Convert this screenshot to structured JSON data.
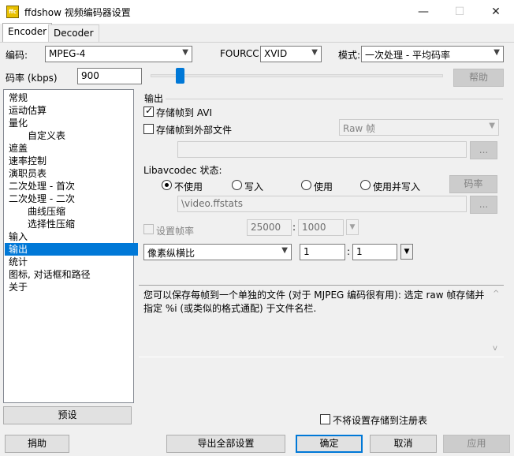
{
  "window": {
    "title": "ffdshow 视频编码器设置",
    "icon_text": "ffc"
  },
  "tabs": [
    {
      "label": "Encoder"
    },
    {
      "label": "Decoder"
    }
  ],
  "top": {
    "codec_label": "编码:",
    "codec_value": "MPEG-4",
    "fourcc_label": "FOURCC:",
    "fourcc_value": "XVID",
    "mode_label": "模式:",
    "mode_value": "一次处理 - 平均码率",
    "bitrate_label": "码率 (kbps)",
    "bitrate_value": "900",
    "slider_fraction": 0.09,
    "help_button": "帮助"
  },
  "tree": [
    {
      "label": "常规"
    },
    {
      "label": "运动估算"
    },
    {
      "label": "量化"
    },
    {
      "label": "自定义表"
    },
    {
      "label": "遮盖"
    },
    {
      "label": "速率控制"
    },
    {
      "label": "演职员表"
    },
    {
      "label": "二次处理 - 首次"
    },
    {
      "label": "二次处理 - 二次"
    },
    {
      "label": "曲线压缩"
    },
    {
      "label": "选择性压缩"
    },
    {
      "label": "输入"
    },
    {
      "label": "输出"
    },
    {
      "label": "统计"
    },
    {
      "label": "图标, 对话框和路径"
    },
    {
      "label": "关于"
    }
  ],
  "preset_button": "预设",
  "output": {
    "group_title": "输出",
    "store_avi_label": "存储帧到 AVI",
    "store_avi_checked": true,
    "store_external_label": "存储帧到外部文件",
    "store_external_checked": false,
    "raw_frame_value": "Raw 帧",
    "browse1": "...",
    "libav_title": "Libavcodec 状态:",
    "radio_not_use": "不使用",
    "radio_write": "写入",
    "radio_use": "使用",
    "radio_use_write": "使用并写入",
    "bitrate_button": "码率",
    "stats_path": "\\video.ffstats",
    "browse2": "...",
    "set_fps_label": "设置帧率",
    "fps_num": "25000",
    "fps_sep": ":",
    "fps_den": "1000",
    "aspect_label": "像素纵横比",
    "aspect_num": "1",
    "aspect_sep": ":",
    "aspect_den": "1",
    "description": "您可以保存每帧到一个单独的文件 (对于 MJPEG 编码很有用): 选定 raw 帧存储并指定 %i (或类似的格式通配) 于文件名栏."
  },
  "registry_checkbox": "不将设置存储到注册表",
  "bottom": {
    "donate": "捐助",
    "export_all": "导出全部设置",
    "ok": "确定",
    "cancel": "取消",
    "apply": "应用"
  },
  "icons": {
    "minimize": "—",
    "maximize": "☐",
    "close": "✕",
    "dropdown": "▼",
    "scroll_up": "^",
    "scroll_down": "v"
  }
}
